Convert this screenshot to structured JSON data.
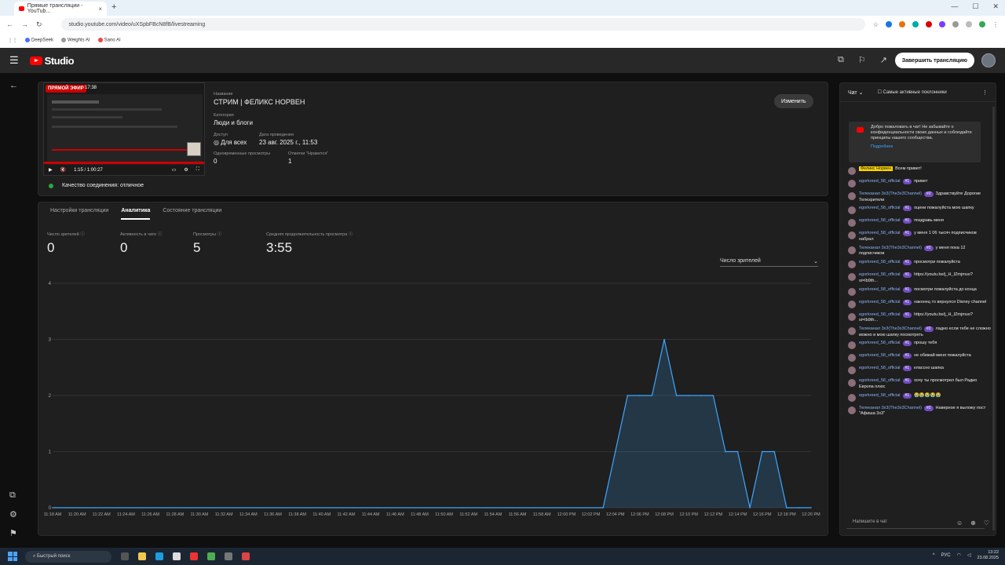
{
  "browser": {
    "tab_title": "Прямые трансляции - YouTub...",
    "url": "studio.youtube.com/video/uXSpbFBcN8fB/livestreaming",
    "bookmarks": [
      "DeepSeek",
      "Weights AI",
      "Sano AI"
    ]
  },
  "studio": {
    "brand": "Studio",
    "end_stream_label": "Завершить трансляцию"
  },
  "stream": {
    "live_badge": "ПРЯМОЙ ЭФИР",
    "live_time": "17:38",
    "player_time": "1:15 / 1:00:27",
    "title_label": "Название",
    "title": "СТРИМ | ФЕЛИКС НОРВЕН",
    "category_label": "Категория",
    "category": "Люди и блоги",
    "access_label": "Доступ",
    "access": "Для всех",
    "date_label": "Дата проведения",
    "date": "23 авг. 2025 г., 11:53",
    "concurrent_label": "Одновременные просмотры",
    "concurrent": "0",
    "likes_label": "Отметки \"Нравится\"",
    "likes": "1",
    "edit_label": "Изменить",
    "connection": "Качество соединения: отличное"
  },
  "tabs": [
    "Настройки трансляции",
    "Аналитика",
    "Состояние трансляции"
  ],
  "metrics": [
    {
      "label": "Число зрителей",
      "value": "0"
    },
    {
      "label": "Активность в чате",
      "value": "0"
    },
    {
      "label": "Просмотры",
      "value": "5"
    },
    {
      "label": "Средняя продолжительность просмотра",
      "value": "3:55"
    }
  ],
  "metric_selector": "Число зрителей",
  "chart_data": {
    "type": "area",
    "title": "",
    "xlabel": "",
    "ylabel": "",
    "ylim": [
      0,
      4
    ],
    "yticks": [
      0,
      1,
      2,
      3,
      4
    ],
    "xticks": [
      "11:18 AM",
      "11:20 AM",
      "11:22 AM",
      "11:24 AM",
      "11:26 AM",
      "11:28 AM",
      "11:30 AM",
      "11:32 AM",
      "11:34 AM",
      "11:36 AM",
      "11:38 AM",
      "11:40 AM",
      "11:42 AM",
      "11:44 AM",
      "11:46 AM",
      "11:48 AM",
      "11:50 AM",
      "11:52 AM",
      "11:54 AM",
      "11:56 AM",
      "11:58 AM",
      "12:00 PM",
      "12:02 PM",
      "12:04 PM",
      "12:06 PM",
      "12:08 PM",
      "12:10 PM",
      "12:12 PM",
      "12:14 PM",
      "12:16 PM",
      "12:18 PM",
      "12:20 PM"
    ],
    "x": [
      "11:18 AM",
      "12:03 PM",
      "12:04 PM",
      "12:05 PM",
      "12:06 PM",
      "12:07 PM",
      "12:08 PM",
      "12:09 PM",
      "12:10 PM",
      "12:11 PM",
      "12:12 PM",
      "12:13 PM",
      "12:14 PM",
      "12:15 PM",
      "12:16 PM",
      "12:17 PM",
      "12:18 PM",
      "12:19 PM",
      "12:20 PM"
    ],
    "values": [
      0,
      0,
      1,
      2,
      2,
      2,
      3,
      2,
      2,
      2,
      2,
      1,
      1,
      0,
      1,
      1,
      0,
      0,
      0
    ],
    "grid": true,
    "color": "#3ea6ff"
  },
  "chat": {
    "title": "Чат",
    "filter": "Самые активные поклонники",
    "welcome": "Добро пожаловать в чат! Не забывайте о конфиденциальности своих данных и соблюдайте принципы нашего сообщества.",
    "welcome_more": "Подробнее",
    "input_placeholder": "Напишите в чат",
    "messages": [
      {
        "name": "Феликс Норвен",
        "badge": "",
        "text": "Всем привет!",
        "owner": true
      },
      {
        "name": "egorkreed_58_official",
        "badge": "#1",
        "text": "привет"
      },
      {
        "name": "Телеканал 3x3(The3x3Channel)",
        "badge": "#2",
        "text": "Здравствуйте Дорогие Телезрители"
      },
      {
        "name": "egorkreed_58_official",
        "badge": "#1",
        "text": "оцени пожалуйста мою шапку"
      },
      {
        "name": "egorkreed_58_official",
        "badge": "#1",
        "text": "поздравь меня"
      },
      {
        "name": "egorkreed_58_official",
        "badge": "#1",
        "text": "у меня 1 06 тысяч подписчиков набрал"
      },
      {
        "name": "Телеканал 3x3(The3x3Channel)",
        "badge": "#2",
        "text": "у меня пока 12 подписчиков"
      },
      {
        "name": "egorkreed_58_official",
        "badge": "#1",
        "text": "просмотри пожалуйста"
      },
      {
        "name": "egorkreed_58_official",
        "badge": "#1",
        "text": "https://youtu.be/j_H_IZmjmuo?si=Ib9th..."
      },
      {
        "name": "egorkreed_58_official",
        "badge": "#1",
        "text": "посмотри пожалуйста до конца"
      },
      {
        "name": "egorkreed_58_official",
        "badge": "#1",
        "text": "наконец то вернулся Disney channel"
      },
      {
        "name": "egorkreed_58_official",
        "badge": "#1",
        "text": "https://youtu.be/j_H_IZmjmuo?si=Ib9th..."
      },
      {
        "name": "Телеканал 3x3(The3x3Channel)",
        "badge": "#2",
        "text": "ладно если тебе не сложно можно и мою шапку посмотреть"
      },
      {
        "name": "egorkreed_58_official",
        "badge": "#1",
        "text": "прошу тебя"
      },
      {
        "name": "egorkreed_58_official",
        "badge": "#1",
        "text": "не обижай меня пожалуйста"
      },
      {
        "name": "egorkreed_58_official",
        "badge": "#1",
        "text": "классно шапка"
      },
      {
        "name": "egorkreed_58_official",
        "badge": "#1",
        "text": "хочу ты просмотрел был Радио Европа плюс"
      },
      {
        "name": "egorkreed_58_official",
        "badge": "#1",
        "text": "😭😭😭😭😭"
      },
      {
        "name": "Телеканал 3x3(The3x3Channel)",
        "badge": "#2",
        "text": "Наверное я выложу пост \"Афиша 3x3\""
      }
    ]
  },
  "taskbar": {
    "search": "Быстрый поиск",
    "lang": "РУС",
    "time": "13:22",
    "date": "23.08.2025"
  }
}
